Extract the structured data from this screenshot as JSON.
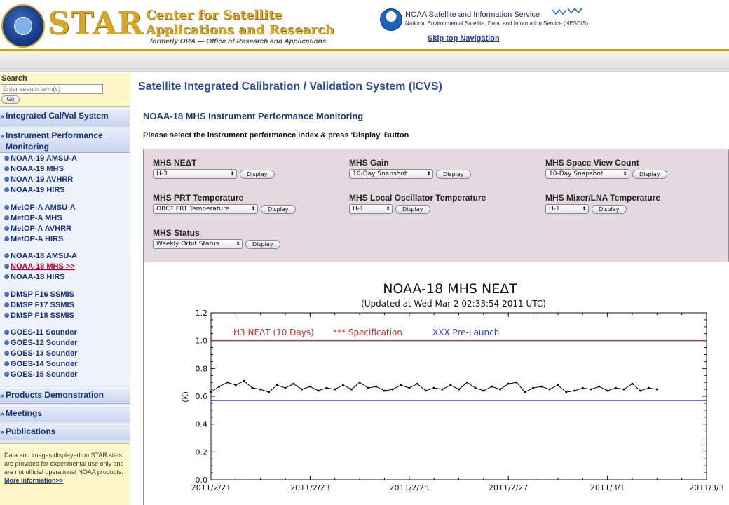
{
  "header": {
    "star_word": "STAR",
    "center_line1": "Center for Satellite",
    "center_line2": "Applications and Research",
    "formerly": "formerly ORA — Office of Research and Applications",
    "nesdis_title": "NOAA Satellite and Information Service",
    "nesdis_sub": "National Environmental Satellite, Data, and Information Service (NESDIS)",
    "skip_nav": "Skip top Navigation",
    "brand_gold": "#d4a72c"
  },
  "sidebar": {
    "search": {
      "label": "Search",
      "placeholder": "Enter search term(s)",
      "go_label": "Go"
    },
    "sections": {
      "icvs": "Integrated Cal/Val System",
      "ipm_line1": "Instrument Performance",
      "ipm_line2": "Monitoring",
      "products": "Products Demonstration",
      "meetings": "Meetings",
      "publications": "Publications"
    },
    "items": [
      "NOAA-19 AMSU-A",
      "NOAA-19 MHS",
      "NOAA-19 AVHRR",
      "NOAA-19 HIRS",
      "MetOP-A AMSU-A",
      "MetOP-A MHS",
      "MetOP-A AVHRR",
      "MetOP-A HIRS",
      "NOAA-18 AMSU-A",
      "NOAA-18 MHS >>",
      "NOAA-18 HIRS",
      "DMSP F16 SSMIS",
      "DMSP F17 SSMIS",
      "DMSP F18 SSMIS",
      "GOES-11 Sounder",
      "GOES-12 Sounder",
      "GOES-13 Sounder",
      "GOES-14 Sounder",
      "GOES-15 Sounder"
    ],
    "disclaimer_text": "Data and images displayed on STAR sites are provided for experimental use only and are not official operational NOAA products.",
    "more_info": "More information>>"
  },
  "main": {
    "title": "Satellite Integrated Calibration / Validation System (ICVS)",
    "subtitle": "NOAA-18 MHS Instrument Performance Monitoring",
    "instructions": "Please select the instrument performance index & press 'Display' Button",
    "display_label": "Display",
    "controls": {
      "nedt": {
        "label": "MHS NEΔT",
        "value": "H-3"
      },
      "gain": {
        "label": "MHS Gain",
        "value": "10-Day Snapshot"
      },
      "space": {
        "label": "MHS Space View Count",
        "value": "10-Day Snapshot"
      },
      "prt": {
        "label": "MHS PRT Temperature",
        "value": "OBCT PRT Temperature"
      },
      "lo": {
        "label": "MHS Local Oscillator Temperature",
        "value": "H-1"
      },
      "mixer": {
        "label": "MHS Mixer/LNA Temperature",
        "value": "H-1"
      },
      "status": {
        "label": "MHS Status",
        "value": "Weekly Orbit Status"
      }
    }
  },
  "chart_data": {
    "type": "line",
    "title": "NOAA-18 MHS NEΔT",
    "subtitle": "(Updated at Wed Mar  2 02:33:54 2011 UTC)",
    "ylabel": "(K)",
    "xlabel": "",
    "ylim": [
      0.0,
      1.2
    ],
    "yticks": [
      "0.0",
      "0.2",
      "0.4",
      "0.6",
      "0.8",
      "1.0",
      "1.2"
    ],
    "xticks": [
      "2011/2/21",
      "2011/2/23",
      "2011/2/25",
      "2011/2/27",
      "2011/3/1",
      "2011/3/3"
    ],
    "xlim": [
      "2011/2/21",
      "2011/3/3"
    ],
    "legend": {
      "series_label": "H3 NEΔT  (10 Days)",
      "spec_label": "*** Specification",
      "prelaunch_label": "XXX Pre-Launch"
    },
    "specification": 1.0,
    "pre_launch": 0.57,
    "colors": {
      "data": "#000000",
      "specification": "#d42a2a",
      "pre_launch": "#2a3fd4"
    },
    "series": [
      {
        "name": "H3 NEΔT  (10 Days)",
        "x": [
          "2011/2/21 00:00",
          "2011/2/21 04:00",
          "2011/2/21 08:00",
          "2011/2/21 12:00",
          "2011/2/21 16:00",
          "2011/2/21 20:00",
          "2011/2/22 00:00",
          "2011/2/22 04:00",
          "2011/2/22 08:00",
          "2011/2/22 12:00",
          "2011/2/22 16:00",
          "2011/2/22 20:00",
          "2011/2/23 00:00",
          "2011/2/23 04:00",
          "2011/2/23 08:00",
          "2011/2/23 12:00",
          "2011/2/23 16:00",
          "2011/2/23 20:00",
          "2011/2/24 00:00",
          "2011/2/24 04:00",
          "2011/2/24 08:00",
          "2011/2/24 12:00",
          "2011/2/24 16:00",
          "2011/2/24 20:00",
          "2011/2/25 00:00",
          "2011/2/25 04:00",
          "2011/2/25 08:00",
          "2011/2/25 12:00",
          "2011/2/25 16:00",
          "2011/2/25 20:00",
          "2011/2/26 00:00",
          "2011/2/26 04:00",
          "2011/2/26 08:00",
          "2011/2/26 12:00",
          "2011/2/26 16:00",
          "2011/2/26 20:00",
          "2011/2/27 00:00",
          "2011/2/27 04:00",
          "2011/2/27 08:00",
          "2011/2/27 12:00",
          "2011/2/27 16:00",
          "2011/2/27 20:00",
          "2011/2/28 00:00",
          "2011/2/28 04:00",
          "2011/2/28 08:00",
          "2011/2/28 12:00",
          "2011/2/28 16:00",
          "2011/2/28 20:00",
          "2011/3/1 00:00",
          "2011/3/1 04:00",
          "2011/3/1 08:00",
          "2011/3/1 12:00",
          "2011/3/1 16:00",
          "2011/3/1 20:00",
          "2011/3/2 00:00"
        ],
        "values": [
          0.63,
          0.67,
          0.7,
          0.68,
          0.71,
          0.66,
          0.65,
          0.63,
          0.68,
          0.66,
          0.69,
          0.65,
          0.67,
          0.64,
          0.66,
          0.65,
          0.68,
          0.65,
          0.7,
          0.66,
          0.67,
          0.64,
          0.65,
          0.68,
          0.66,
          0.69,
          0.64,
          0.66,
          0.65,
          0.68,
          0.65,
          0.7,
          0.66,
          0.64,
          0.67,
          0.65,
          0.69,
          0.7,
          0.63,
          0.66,
          0.67,
          0.65,
          0.68,
          0.63,
          0.64,
          0.66,
          0.65,
          0.67,
          0.64,
          0.66,
          0.65,
          0.69,
          0.64,
          0.66,
          0.65
        ]
      }
    ]
  }
}
